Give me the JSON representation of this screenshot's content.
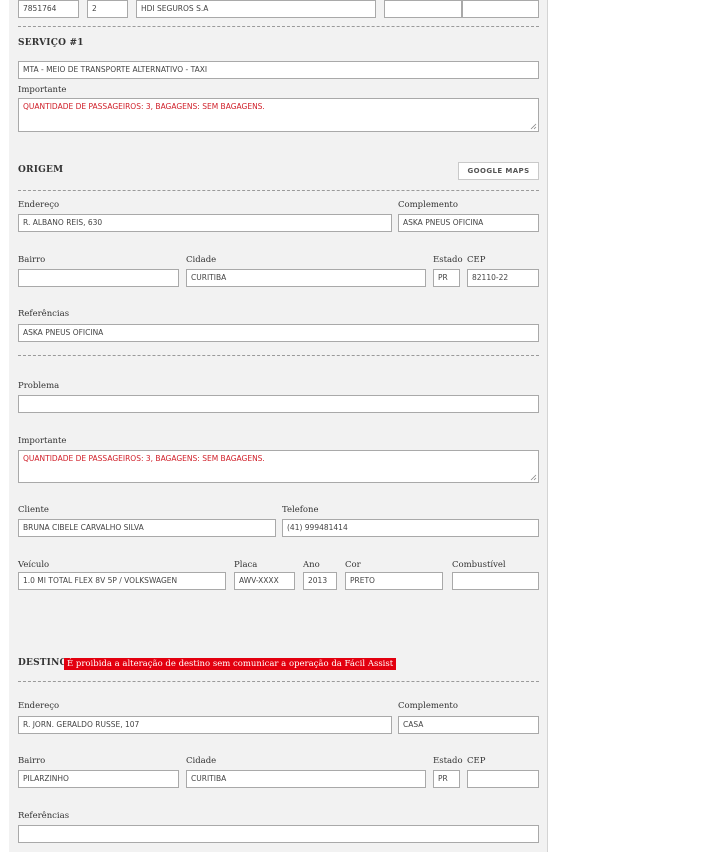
{
  "top_row": {
    "field1": "7851764",
    "field2": "2",
    "insurer": "HDI SEGUROS S.A",
    "field4": "",
    "field5": ""
  },
  "service": {
    "title": "SERVIÇO #1",
    "type_value": "MTA - MEIO DE TRANSPORTE ALTERNATIVO - TAXI",
    "important_label": "Importante",
    "important_value": "QUANTIDADE DE PASSAGEIROS: 3, BAGAGENS: SEM BAGAGENS."
  },
  "origin": {
    "title": "ORIGEM",
    "maps_button": "GOOGLE MAPS",
    "address_label": "Endereço",
    "address_value": "R. ALBANO REIS, 630",
    "complement_label": "Complemento",
    "complement_value": "ASKA PNEUS OFICINA",
    "district_label": "Bairro",
    "district_value": "",
    "city_label": "Cidade",
    "city_value": "CURITIBA",
    "state_label": "Estado",
    "state_value": "PR",
    "zip_label": "CEP",
    "zip_value": "82110-22",
    "references_label": "Referências",
    "references_value": "ASKA PNEUS OFICINA"
  },
  "problem": {
    "problem_label": "Problema",
    "problem_value": "",
    "important_label": "Importante",
    "important_value": "QUANTIDADE DE PASSAGEIROS: 3, BAGAGENS: SEM BAGAGENS.",
    "client_label": "Cliente",
    "client_value": "BRUNA CIBELE CARVALHO SILVA",
    "phone_label": "Telefone",
    "phone_value": "(41) 999481414",
    "vehicle_label": "Veículo",
    "vehicle_value": "1.0 MI TOTAL FLEX 8V 5P / VOLKSWAGEN",
    "plate_label": "Placa",
    "plate_value": "AWV-XXXX",
    "year_label": "Ano",
    "year_value": "2013",
    "color_label": "Cor",
    "color_value": "PRETO",
    "fuel_label": "Combustível",
    "fuel_value": ""
  },
  "destination": {
    "title": "DESTINO",
    "warning": "É proibida a alteração de destino sem comunicar a operação da Fácil Assist",
    "address_label": "Endereço",
    "address_value": "R. JORN. GERALDO RUSSE, 107",
    "complement_label": "Complemento",
    "complement_value": "CASA",
    "district_label": "Bairro",
    "district_value": "PILARZINHO",
    "city_label": "Cidade",
    "city_value": "CURITIBA",
    "state_label": "Estado",
    "state_value": "PR",
    "zip_label": "CEP",
    "zip_value": "",
    "references_label": "Referências",
    "references_value": ""
  },
  "colors": {
    "panel_bg": "#f2f2f2",
    "important_text": "#d0202a",
    "warning_bg": "#e3000f"
  }
}
